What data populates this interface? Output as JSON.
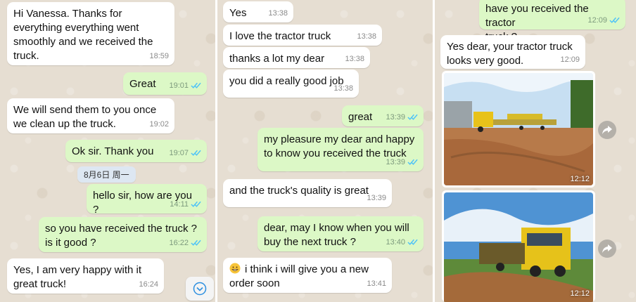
{
  "panel1": {
    "messages": [
      {
        "text": "Hi Vanessa. Thanks for\neverything everything went\nsmoothly and we received the\ntruck.",
        "time": "18:59"
      },
      {
        "text": "Great",
        "time": "19:01"
      },
      {
        "text": "We will send them to you once\nwe clean up the truck.",
        "time": "19:02"
      },
      {
        "text": "Ok sir. Thank you",
        "time": "19:07"
      },
      {
        "text": "hello sir, how are you ?",
        "time": "14:11"
      },
      {
        "text": "so you have received the truck ?\nis it good ?",
        "time": "16:22"
      },
      {
        "text": "Yes, I am very happy with it\ngreat truck!",
        "time": "16:24"
      }
    ],
    "date_chip": "8月6日 周一",
    "scroll_icon": "chevron-down-circle-icon"
  },
  "panel2": {
    "messages": [
      {
        "text": "Yes",
        "time": "13:38"
      },
      {
        "text": "I love the tractor truck",
        "time": "13:38"
      },
      {
        "text": "thanks a lot my dear",
        "time": "13:38"
      },
      {
        "text": "you did a really good job",
        "time": "13:38"
      },
      {
        "text": "great",
        "time": "13:39"
      },
      {
        "text": "my pleasure my dear and happy\nto know you received the truck",
        "time": "13:39"
      },
      {
        "text": "and the truck's quality is great",
        "time": "13:39"
      },
      {
        "text": "dear, may I know when you will\nbuy the next truck ?",
        "time": "13:40"
      },
      {
        "text": "i think i will give you a new\norder soon",
        "time": "13:41",
        "emoji": "grinning-face-icon"
      }
    ]
  },
  "panel3": {
    "messages": [
      {
        "text": "have you received the tractor\ntruck ?",
        "time": "12:09"
      },
      {
        "text": "Yes dear, your tractor truck\nlooks very good.",
        "time": "12:09"
      }
    ],
    "photos": [
      {
        "time": "12:12",
        "subject": "yellow-tractor-truck-with-lowbed-trailer"
      },
      {
        "time": "12:12",
        "subject": "yellow-truck-hauling-trailer"
      }
    ],
    "forward_icon": "share-forward-icon"
  },
  "colors": {
    "incoming": "#ffffff",
    "outgoing": "#dcf8c6",
    "read_ticks": "#4fc3f7",
    "background": "#e6ded2"
  }
}
